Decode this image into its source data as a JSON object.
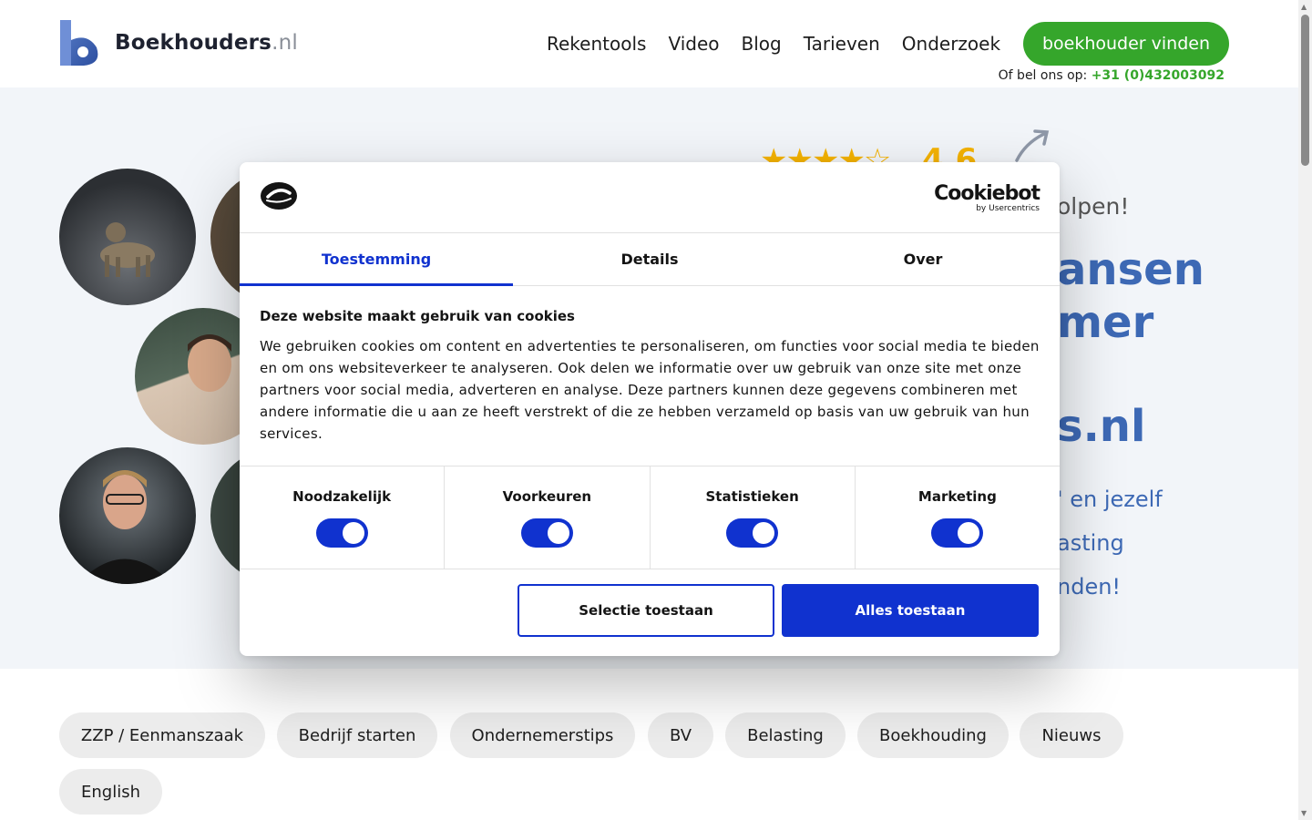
{
  "header": {
    "logo_name": "Boekhouders",
    "logo_tld": ".nl",
    "nav": [
      "Rekentools",
      "Video",
      "Blog",
      "Tarieven",
      "Onderzoek"
    ],
    "cta_label": "boekhouder vinden",
    "call_prefix": "Of bel ons op:",
    "call_phone": "+31 (0)432003092",
    "colors": {
      "green": "#35a62b",
      "logo_blue": "#3d69b5"
    }
  },
  "hero": {
    "stars": "★★★★☆",
    "rating": "4.6",
    "rating_value": 4.6,
    "sub": "olpen!",
    "heading_1": "ansen",
    "heading_2": "mer",
    "heading_3": "s.nl",
    "line_1": "' en jezelf",
    "line_2": "asting",
    "line_3": "nden!"
  },
  "categories": [
    "ZZP / Eenmanszaak",
    "Bedrijf starten",
    "Ondernemerstips",
    "BV",
    "Belasting",
    "Boekhouding",
    "Nieuws",
    "English"
  ],
  "cookie_dialog": {
    "brand": "Cookiebot",
    "brand_sub": "by Usercentrics",
    "tabs": [
      "Toestemming",
      "Details",
      "Over"
    ],
    "active_tab": "Toestemming",
    "title": "Deze website maakt gebruik van cookies",
    "text": "We gebruiken cookies om content en advertenties te personaliseren, om functies voor social media te bieden en om ons websiteverkeer te analyseren. Ook delen we informatie over uw gebruik van onze site met onze partners voor social media, adverteren en analyse. Deze partners kunnen deze gegevens combineren met andere informatie die u aan ze heeft verstrekt of die ze hebben verzameld op basis van uw gebruik van hun services.",
    "toggles": [
      {
        "label": "Noodzakelijk",
        "on": true
      },
      {
        "label": "Voorkeuren",
        "on": true
      },
      {
        "label": "Statistieken",
        "on": true
      },
      {
        "label": "Marketing",
        "on": true
      }
    ],
    "btn_selection": "Selectie toestaan",
    "btn_all": "Alles toestaan",
    "accent": "#1032cf"
  }
}
